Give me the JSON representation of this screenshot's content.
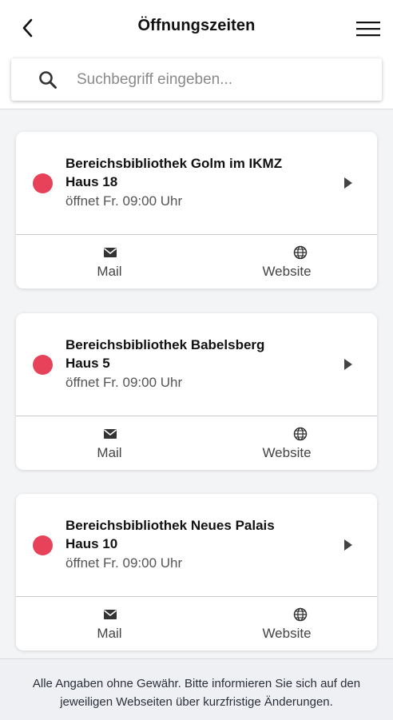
{
  "header": {
    "title": "Öffnungszeiten",
    "back_icon": "chevron-left-icon",
    "menu_icon": "hamburger-menu-icon"
  },
  "search": {
    "placeholder": "Suchbegriff eingeben...",
    "value": "",
    "icon": "search-icon"
  },
  "colors": {
    "status_closed": "#e8425a",
    "text_primary": "#111111",
    "text_secondary": "#555555",
    "background": "#f3f4f6"
  },
  "libraries": [
    {
      "name": "Bereichsbibliothek Golm im IKMZ",
      "house": "Haus 18",
      "hours": "öffnet Fr. 09:00 Uhr",
      "status": "closed",
      "mail_label": "Mail",
      "website_label": "Website"
    },
    {
      "name": "Bereichsbibliothek Babelsberg",
      "house": "Haus 5",
      "hours": "öffnet Fr. 09:00 Uhr",
      "status": "closed",
      "mail_label": "Mail",
      "website_label": "Website"
    },
    {
      "name": "Bereichsbibliothek Neues Palais",
      "house": "Haus 10",
      "hours": "öffnet Fr. 09:00 Uhr",
      "status": "closed",
      "mail_label": "Mail",
      "website_label": "Website"
    }
  ],
  "footer": {
    "line1": "Alle Angaben ohne Gewähr. Bitte informieren Sie sich auf den",
    "line2": "jeweiligen Webseiten über kurzfristige Änderungen."
  }
}
